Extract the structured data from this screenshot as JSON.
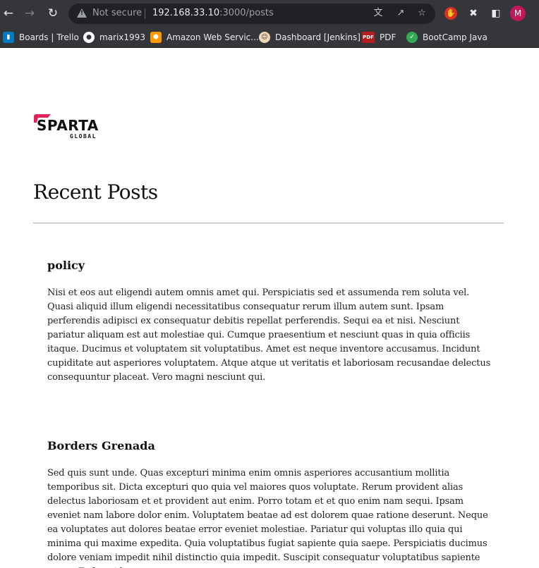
{
  "browser": {
    "security_label": "Not secure",
    "url_host": "192.168.33.10",
    "url_rest": ":3000/posts",
    "profile_initial": "M",
    "bookmarks": [
      {
        "label": "Boards | Trello",
        "icon": "trello-icon",
        "color": "#0079bf"
      },
      {
        "label": "marix1993",
        "icon": "github-icon",
        "color": "#ffffff"
      },
      {
        "label": "Amazon Web Servic...",
        "icon": "aws-icon",
        "color": "#ff9900"
      },
      {
        "label": "Dashboard [Jenkins]",
        "icon": "jenkins-icon",
        "color": "#d33833"
      },
      {
        "label": "PDF",
        "icon": "pdf-icon",
        "color": "#b71c1c"
      },
      {
        "label": "BootCamp Java",
        "icon": "bootcamp-icon",
        "color": "#34a853"
      }
    ]
  },
  "page": {
    "logo": {
      "word": "SPARTA",
      "sub": "GLOBAL",
      "accent": "#e5235a"
    },
    "title": "Recent Posts",
    "posts": [
      {
        "title": "policy",
        "body": "Nisi et eos aut eligendi autem omnis amet qui. Perspiciatis sed et assumenda rem soluta vel. Quasi aliquid illum eligendi necessitatibus consequatur rerum illum autem sunt. Ipsam perferendis adipisci ex consequatur debitis repellat perferendis. Sequi ea et nisi. Nesciunt pariatur aliquam est aut molestiae qui. Cumque praesentium et nesciunt quas in quia officiis itaque. Ducimus et voluptatem sit voluptatibus. Amet est neque inventore accusamus. Incidunt cupiditate aut asperiores voluptatem. Atque atque ut veritatis et laboriosam recusandae delectus consequuntur placeat. Vero magni nesciunt qui."
      },
      {
        "title": "Borders Grenada",
        "body": "Sed quis sunt unde. Quas excepturi minima enim omnis asperiores accusantium mollitia temporibus sit. Dicta excepturi quo quia vel maiores quos voluptate. Rerum provident alias delectus laboriosam et et provident aut enim. Porro totam et et quo enim nam sequi. Ipsam eveniet nam labore dolor enim. Voluptatem beatae ad est dolorem quae ratione deserunt. Neque ea voluptates aut dolores beatae error eveniet molestiae. Pariatur qui voluptas illo quia qui minima qui maxime expedita. Quia voluptatibus fugiat sapiente quia saepe. Perspiciatis ducimus dolore veniam impedit nihil distinctio quia impedit. Suscipit consequatur voluptatibus sapiente natus. Et fuga id"
      }
    ]
  }
}
